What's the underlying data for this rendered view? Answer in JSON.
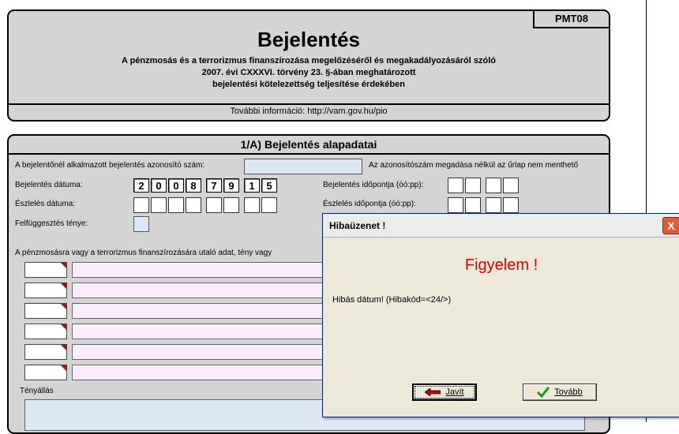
{
  "header": {
    "form_code": "PMT08",
    "title": "Bejelentés",
    "subtitle_line1": "A pénzmosás és a terrorizmus finanszírozása megelőzéséről és megakadályozásáról szóló",
    "subtitle_line2": "2007. évi CXXXVI. törvény 23. §-ában meghatározott",
    "subtitle_line3": "bejelentési kötelezettség teljesítése érdekében",
    "info": "További információ: http://vam.gov.hu/pio"
  },
  "section": {
    "title": "1/A) Bejelentés alapadatai",
    "id_label": "A bejelentőnél alkalmazott bejelentés azonosító szám:",
    "id_note": "Az azonosítószám megadása nélkül az űrlap nem menthető",
    "id_value": "",
    "report_date_label": "Bejelentés dátuma:",
    "report_date_digits": [
      "2",
      "0",
      "0",
      "8",
      "7",
      "9",
      "1",
      "5"
    ],
    "report_time_label": "Bejelentés időpontja (óó:pp):",
    "detect_date_label": "Észlelés dátuma:",
    "detect_time_label": "Észlelés időpontja (óó:pp):",
    "suspension_label": "Felfüggesztés ténye:",
    "indicator_label": "A pénzmosásra vagy a terrorizmus finanszírozására utaló adat, tény vagy",
    "facts_label": "Tényállás"
  },
  "dialog": {
    "title": "Hibaüzenet !",
    "close_glyph": "X",
    "headline": "Figyelem !",
    "message": "Hibás dátum! (Hibakód=<24/>)",
    "fix_button": "Javít",
    "continue_button": "Tovább"
  },
  "colors": {
    "panel": "#d4d4d4",
    "field_blue": "#dde8f7",
    "field_pink": "#fbecfb",
    "alert_red": "#e00000",
    "marker_red": "#cc0000"
  }
}
